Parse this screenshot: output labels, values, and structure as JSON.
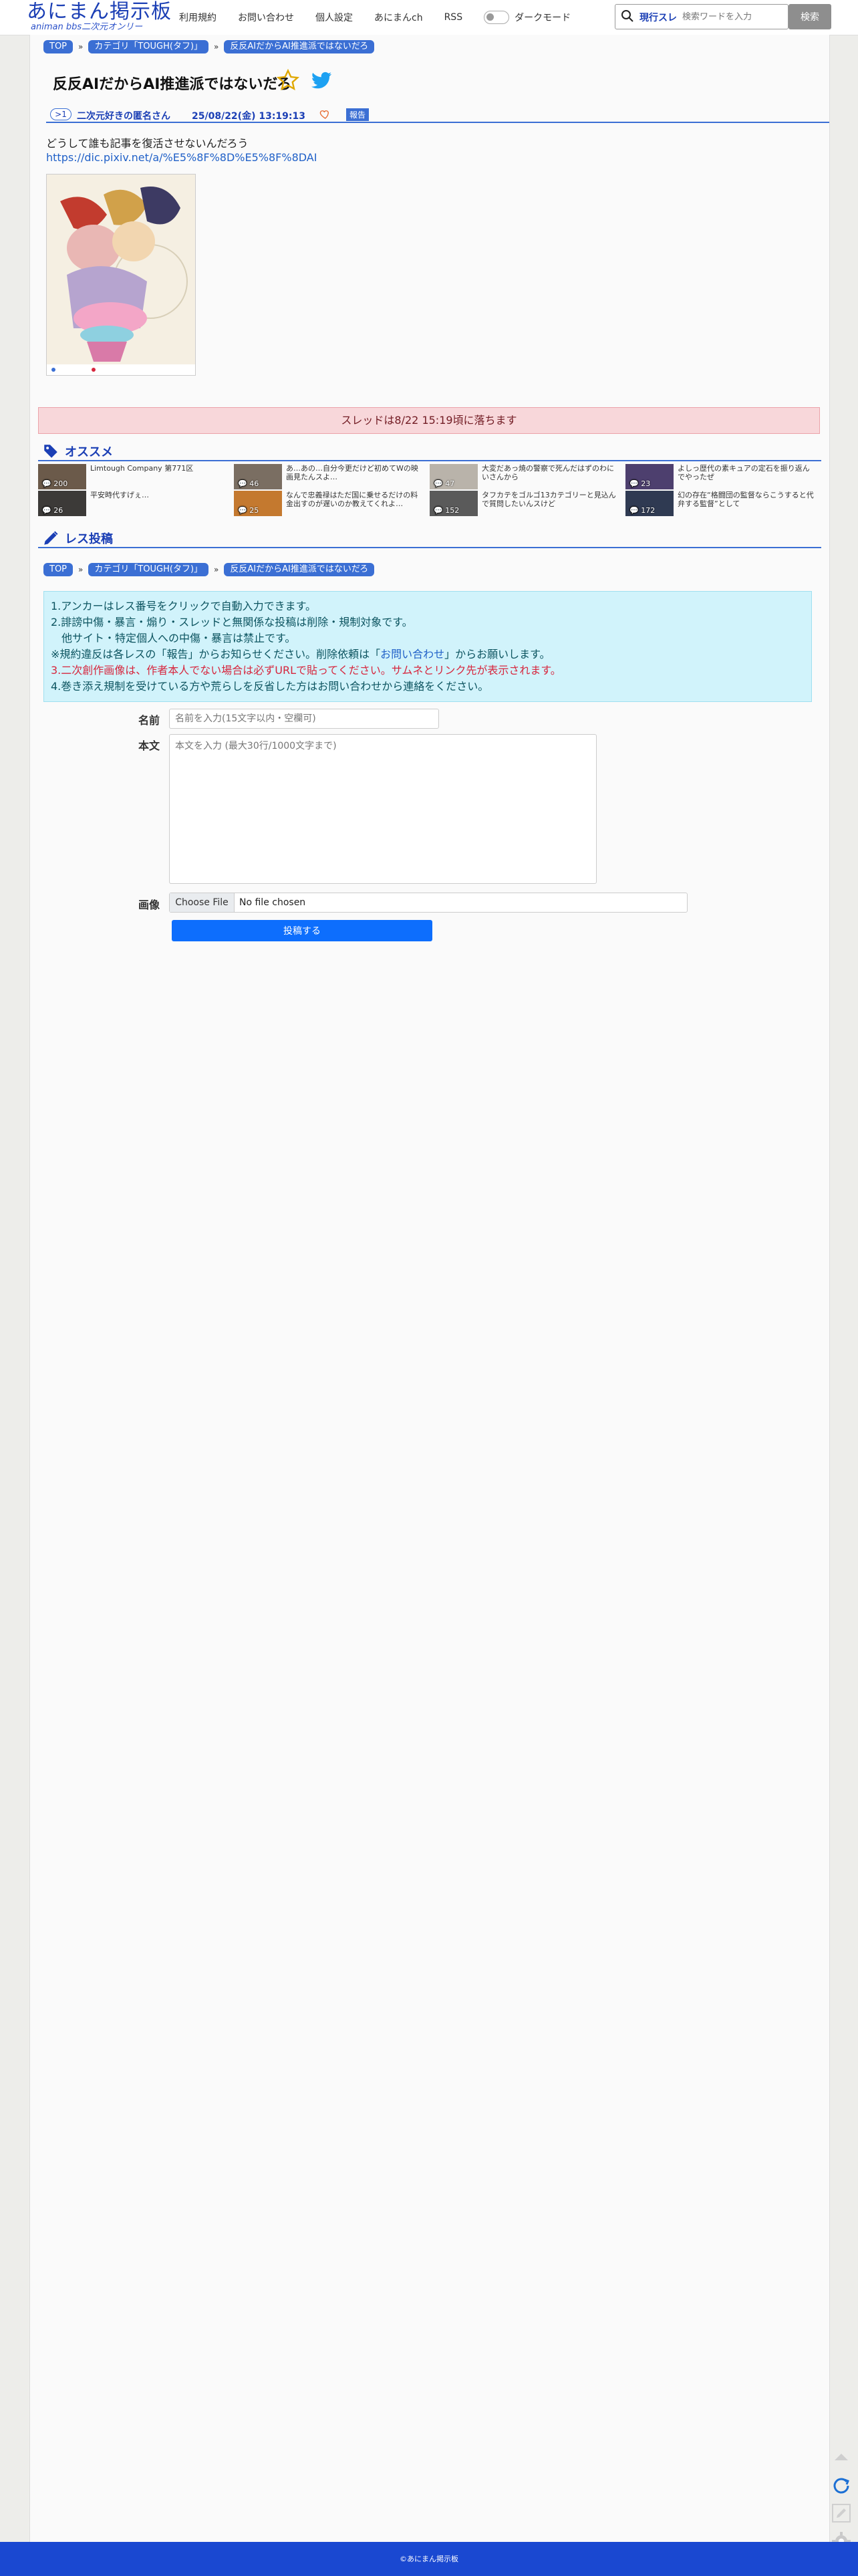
{
  "header": {
    "logo_main": "あにまん掲示板",
    "logo_sub": "animan bbs二次元オンリー",
    "nav": [
      "利用規約",
      "お問い合わせ",
      "個人設定",
      "あにまんch",
      "RSS"
    ],
    "dark_mode_label": "ダークモード",
    "search_kind": "現行スレ",
    "search_placeholder": "検索ワードを入力",
    "search_button": "検索"
  },
  "breadcrumb": {
    "top": "TOP",
    "category": "カテゴリ「TOUGH(タフ)」",
    "thread": "反反AIだからAI推進派ではないだろ"
  },
  "thread": {
    "title": "反反AIだからAI推進派ではないだろ",
    "post": {
      "number": ">1",
      "name": "二次元好きの匿名さん",
      "date": "25/08/22(金) 13:19:13",
      "report_label": "報告",
      "body": "どうして誰も記事を復活させないんだろう",
      "link": "https://dic.pixiv.net/a/%E5%8F%8D%E5%8F%8DAI"
    }
  },
  "notice": "スレッドは8/22 15:19頃に落ちます",
  "recommend": {
    "title": "オススメ",
    "items": [
      {
        "title": "Limtough Company 第771区",
        "count": "200"
      },
      {
        "title": "あ…あの…自分今更だけど初めてWの映画見たんスよ…",
        "count": "46"
      },
      {
        "title": "大変だあっ焼の警察で死んだはずのわにいさんから",
        "count": "47"
      },
      {
        "title": "よしっ歴代の素キュアの定石を振り返んでやったぜ",
        "count": "23"
      },
      {
        "title": "平安時代すげぇ…",
        "count": "26"
      },
      {
        "title": "なんで忠義禄はただ国に乗せるだけの料金出すのが遅いのか教えてくれよ…",
        "count": "25"
      },
      {
        "title": "タフカテをゴルゴ13カテゴリーと見込んで質問したいんスけど",
        "count": "152"
      },
      {
        "title": "幻の存在“格闘団の監督ならこうすると代弁する監督”として",
        "count": "172"
      }
    ]
  },
  "reply": {
    "title": "レス投稿",
    "rules": {
      "r1": "1.アンカーはレス番号をクリックで自動入力できます。",
      "r2": "2.誹謗中傷・暴言・煽り・スレッドと無関係な投稿は削除・規制対象です。",
      "r2b": "他サイト・特定個人への中傷・暴言は禁止です。",
      "r3a": "※規約違反は各レスの「報告」からお知らせください。削除依頼は「",
      "r3link": "お問い合わせ",
      "r3b": "」からお願いします。",
      "r4": "3.二次創作画像は、作者本人でない場合は必ずURLで貼ってください。サムネとリンク先が表示されます。",
      "r5": "4.巻き添え規制を受けている方や荒らしを反省した方はお問い合わせから連絡をください。"
    },
    "name_label": "名前",
    "name_placeholder": "名前を入力(15文字以内・空欄可)",
    "body_label": "本文",
    "body_placeholder": "本文を入力 (最大30行/1000文字まで)",
    "image_label": "画像",
    "file_button": "Choose File",
    "file_status": "No file chosen",
    "submit": "投稿する"
  },
  "footer": "©あにまん掲示板",
  "colors": {
    "brand": "#1a48d1",
    "accent": "#3b6fd4",
    "notice_bg": "#f8d7da",
    "rules_bg": "#d1f3fb"
  }
}
